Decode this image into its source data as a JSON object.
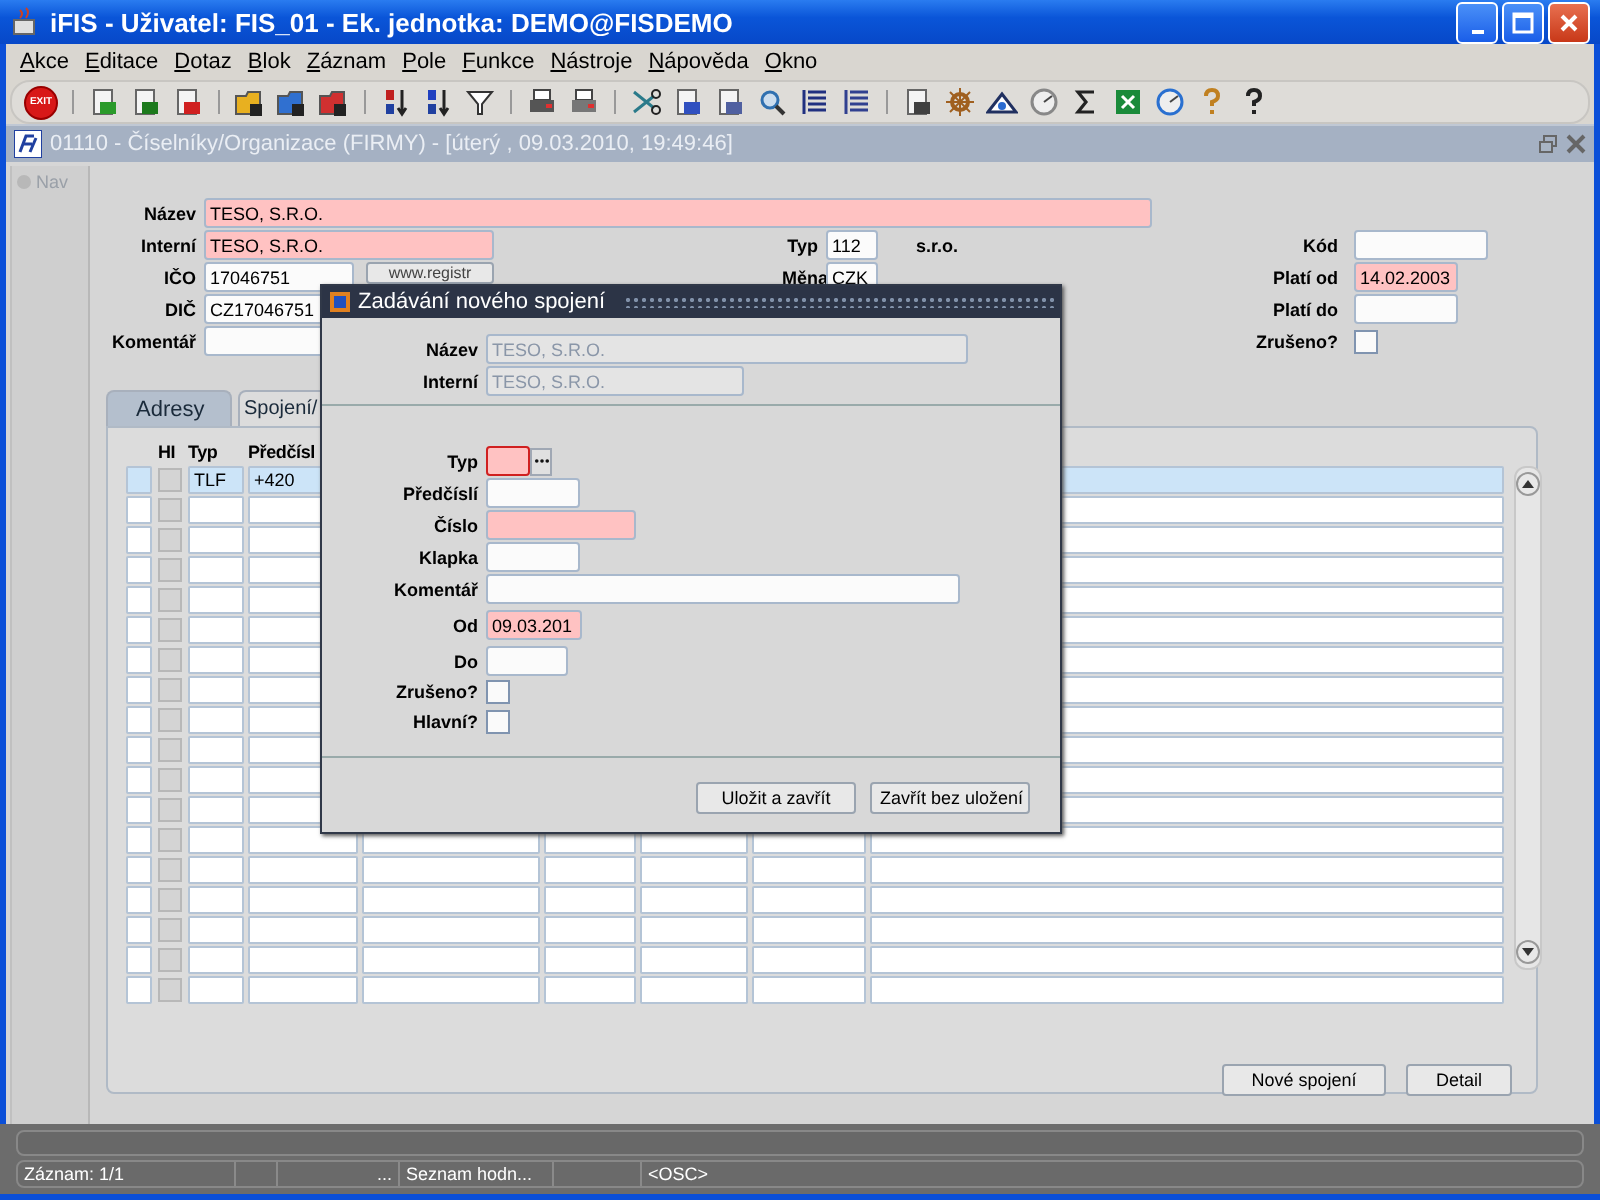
{
  "window": {
    "title": "iFIS - Uživatel: FIS_01 - Ek. jednotka: DEMO@FISDEMO"
  },
  "menu": [
    "Akce",
    "Editace",
    "Dotaz",
    "Blok",
    "Záznam",
    "Pole",
    "Funkce",
    "Nástroje",
    "Nápověda",
    "Okno"
  ],
  "toolbar": {
    "exit_label": "EXIT"
  },
  "form_window": {
    "title": "01110 - Číselníky/Organizace (FIRMY) - [úterý , 09.03.2010, 19:49:46]"
  },
  "nav": {
    "label": "Nav"
  },
  "form": {
    "nazev": {
      "label": "Název",
      "value": "TESO, S.R.O.",
      "required": true
    },
    "interni": {
      "label": "Interní",
      "value": "TESO, S.R.O.",
      "required": true
    },
    "ico": {
      "label": "IČO",
      "value": "17046751",
      "required": false
    },
    "registr_button": "www.registr",
    "dic": {
      "label": "DIČ",
      "value": "CZ17046751",
      "required": false
    },
    "komentar": {
      "label": "Komentář",
      "required": false
    },
    "typ": {
      "label": "Typ",
      "value": "112",
      "required": false
    },
    "typ_name": "s.r.o.",
    "mena": {
      "label": "Měna",
      "value": "CZK",
      "required": false
    },
    "kod": {
      "label": "Kód",
      "required": false
    },
    "plati_od": {
      "label": "Platí od",
      "value": "14.02.2003",
      "required": true
    },
    "plati_do": {
      "label": "Platí do",
      "required": false
    },
    "zruseno": {
      "label": "Zrušeno?",
      "checked": false
    }
  },
  "tabs": [
    {
      "label": "Adresy",
      "selected": false
    },
    {
      "label": "Spojení/",
      "selected": true
    }
  ],
  "contacts": {
    "columns": [
      "HI",
      "Typ",
      "Předčísl"
    ],
    "rows": [
      {
        "hi": false,
        "typ": "TLF",
        "predcisli": "+420",
        "selected": true
      },
      {
        "hi": false,
        "selected": false
      },
      {
        "hi": false,
        "selected": false
      },
      {
        "hi": false,
        "selected": false
      },
      {
        "hi": false,
        "selected": false
      },
      {
        "hi": false,
        "selected": false
      },
      {
        "hi": false,
        "selected": false
      },
      {
        "hi": false,
        "selected": false
      },
      {
        "hi": false,
        "selected": false
      },
      {
        "hi": false,
        "selected": false
      },
      {
        "hi": false,
        "selected": false
      },
      {
        "hi": false,
        "selected": false
      },
      {
        "hi": false,
        "selected": false
      },
      {
        "hi": false,
        "selected": false
      },
      {
        "hi": false,
        "selected": false
      },
      {
        "hi": false,
        "selected": false
      },
      {
        "hi": false,
        "selected": false
      },
      {
        "hi": false,
        "selected": false
      }
    ],
    "buttons": [
      "Nové spojení",
      "Detail"
    ]
  },
  "dialog": {
    "title": "Zadávání nového spojení",
    "header": [
      {
        "label": "Název",
        "value": "TESO, S.R.O.",
        "disabled": true
      },
      {
        "label": "Interní",
        "value": "TESO, S.R.O.",
        "disabled": true
      }
    ],
    "fields": [
      {
        "kind": "lov",
        "label": "Typ",
        "required": true,
        "focused": true
      },
      {
        "kind": "text",
        "label": "Předčíslí",
        "required": false,
        "focused": false
      },
      {
        "kind": "text",
        "label": "Číslo",
        "required": true,
        "focused": false
      },
      {
        "kind": "text",
        "label": "Klapka",
        "required": false,
        "focused": false
      },
      {
        "kind": "text",
        "label": "Komentář",
        "required": false,
        "focused": false
      },
      {
        "kind": "text",
        "label": "Od",
        "value": "09.03.201",
        "required": true,
        "focused": false
      },
      {
        "kind": "text",
        "label": "Do",
        "required": false,
        "focused": false
      },
      {
        "kind": "checkbox",
        "label": "Zrušeno?",
        "checked": false
      },
      {
        "kind": "checkbox",
        "label": "Hlavní?",
        "checked": false
      }
    ],
    "buttons": [
      "Uložit a zavřít",
      "Zavřít bez uložení"
    ]
  },
  "status_bar": {
    "record": "Záznam: 1/1",
    "ellipsis": "...",
    "list_hint": "Seznam hodn...",
    "mode": "<OSC>"
  }
}
